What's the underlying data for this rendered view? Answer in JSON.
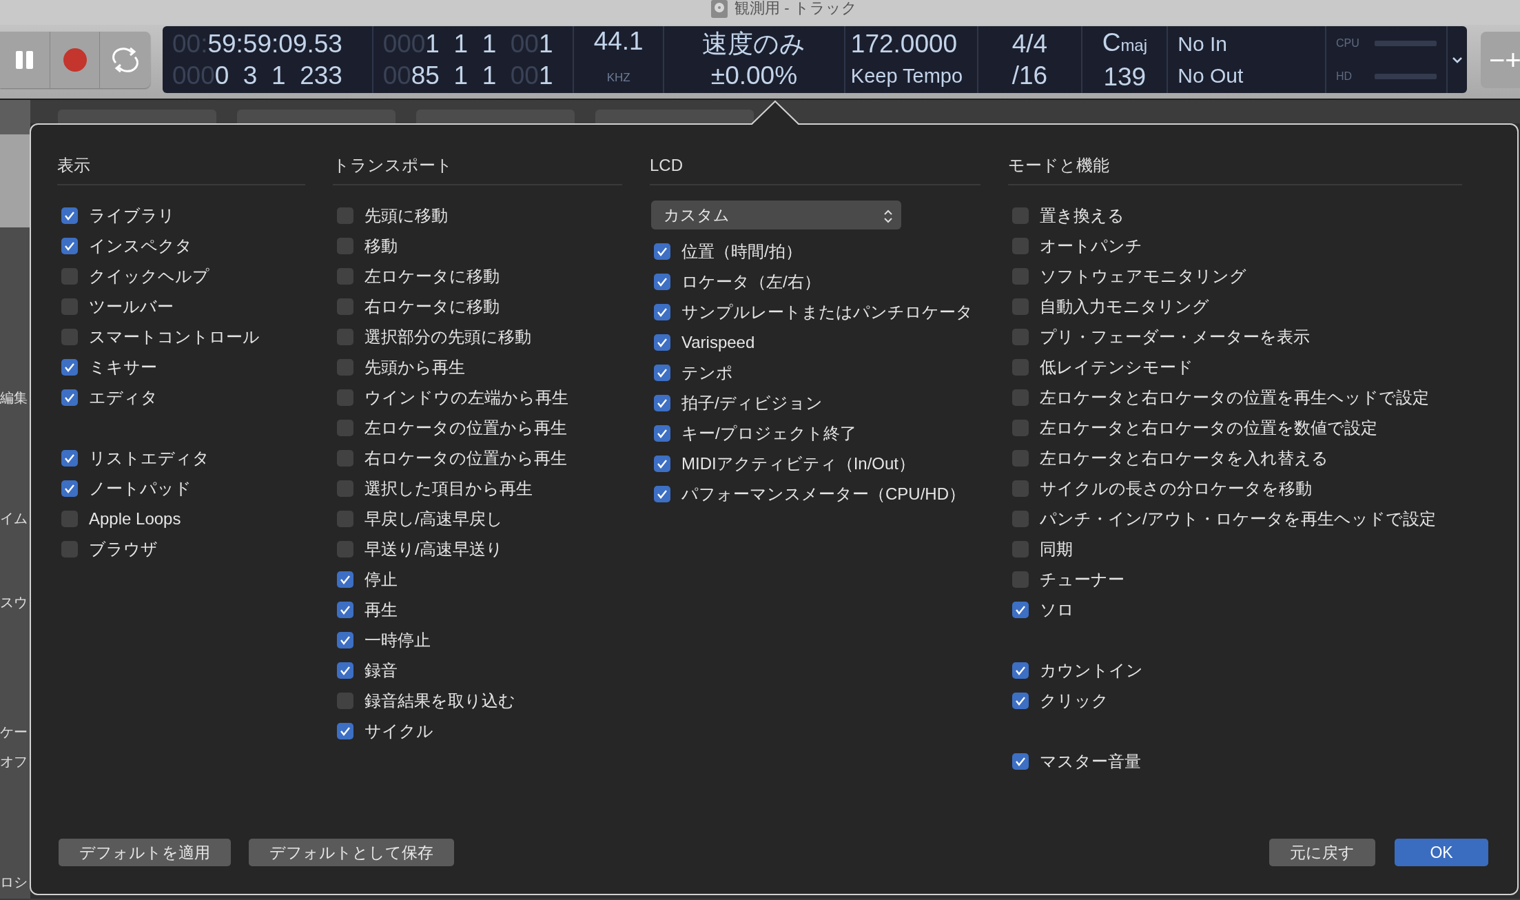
{
  "window": {
    "title": "観測用 - トラック"
  },
  "transport": [
    {
      "kind": "pause"
    },
    {
      "kind": "record"
    },
    {
      "kind": "cycle"
    }
  ],
  "lcd": {
    "segments": [
      {
        "lines": [
          [
            {
              "text": "00:",
              "dim": true
            },
            {
              "text": "59:59:09.53"
            }
          ],
          [
            {
              "text": "000",
              "dim": true
            },
            {
              "text": "0  3  1  233"
            }
          ]
        ]
      },
      {
        "lines": [
          [
            {
              "text": "000",
              "dim": true
            },
            {
              "text": "1  1  1  "
            },
            {
              "text": "00",
              "dim": true
            },
            {
              "text": "1"
            }
          ],
          [
            {
              "text": "00",
              "dim": true
            },
            {
              "text": "85  1  1  "
            },
            {
              "text": "00",
              "dim": true
            },
            {
              "text": "1"
            }
          ]
        ]
      },
      {
        "lines": [
          [
            {
              "text": "44.1"
            }
          ],
          [
            {
              "text": "KHZ",
              "small": true
            }
          ]
        ]
      },
      {
        "lines": [
          [
            {
              "text": "速度のみ"
            }
          ],
          [
            {
              "text": "±0.00%"
            }
          ]
        ]
      },
      {
        "lines": [
          [
            {
              "text": "172.0000"
            }
          ],
          [
            {
              "text": "Keep Tempo"
            }
          ]
        ]
      },
      {
        "lines": [
          [
            {
              "text": "4/4"
            }
          ],
          [
            {
              "text": "/16"
            }
          ]
        ]
      },
      {
        "lines": [
          [
            {
              "text": "C"
            },
            {
              "text": "maj",
              "small": true
            }
          ],
          [
            {
              "text": "139"
            }
          ]
        ]
      },
      {
        "lines": [
          [
            {
              "text": "No In"
            }
          ],
          [
            {
              "text": "No Out"
            }
          ]
        ]
      }
    ],
    "meters": [
      {
        "label": "CPU",
        "level": 0
      },
      {
        "label": "HD",
        "level": 0
      }
    ]
  },
  "zoom_button": "−+",
  "background": {
    "fragments": [
      "編集",
      "イム",
      "スウ",
      "ケー",
      "オフ",
      "ロシ"
    ]
  },
  "dialog": {
    "columns": [
      {
        "heading": "表示",
        "groups": [
          [
            {
              "label": "ライブラリ",
              "checked": true
            },
            {
              "label": "インスペクタ",
              "checked": true
            },
            {
              "label": "クイックヘルプ",
              "checked": false
            },
            {
              "label": "ツールバー",
              "checked": false
            },
            {
              "label": "スマートコントロール",
              "checked": false
            },
            {
              "label": "ミキサー",
              "checked": true
            },
            {
              "label": "エディタ",
              "checked": true
            }
          ],
          [
            {
              "label": "リストエディタ",
              "checked": true
            },
            {
              "label": "ノートパッド",
              "checked": true
            },
            {
              "label": "Apple Loops",
              "checked": false
            },
            {
              "label": "ブラウザ",
              "checked": false
            }
          ]
        ]
      },
      {
        "heading": "トランスポート",
        "groups": [
          [
            {
              "label": "先頭に移動",
              "checked": false
            },
            {
              "label": "移動",
              "checked": false
            },
            {
              "label": "左ロケータに移動",
              "checked": false
            },
            {
              "label": "右ロケータに移動",
              "checked": false
            },
            {
              "label": "選択部分の先頭に移動",
              "checked": false
            },
            {
              "label": "先頭から再生",
              "checked": false
            },
            {
              "label": "ウインドウの左端から再生",
              "checked": false
            },
            {
              "label": "左ロケータの位置から再生",
              "checked": false
            },
            {
              "label": "右ロケータの位置から再生",
              "checked": false
            },
            {
              "label": "選択した項目から再生",
              "checked": false
            },
            {
              "label": "早戻し/高速早戻し",
              "checked": false
            },
            {
              "label": "早送り/高速早送り",
              "checked": false
            },
            {
              "label": "停止",
              "checked": true
            },
            {
              "label": "再生",
              "checked": true
            },
            {
              "label": "一時停止",
              "checked": true
            },
            {
              "label": "録音",
              "checked": true
            },
            {
              "label": "録音結果を取り込む",
              "checked": false
            },
            {
              "label": "サイクル",
              "checked": true
            }
          ]
        ]
      },
      {
        "heading": "LCD",
        "dropdown": "カスタム",
        "groups": [
          [
            {
              "label": "位置（時間/拍）",
              "checked": true
            },
            {
              "label": "ロケータ（左/右）",
              "checked": true
            },
            {
              "label": "サンプルレートまたはパンチロケータ",
              "checked": true
            },
            {
              "label": "Varispeed",
              "checked": true
            },
            {
              "label": "テンポ",
              "checked": true
            },
            {
              "label": "拍子/ディビジョン",
              "checked": true
            },
            {
              "label": "キー/プロジェクト終了",
              "checked": true
            },
            {
              "label": "MIDIアクティビティ（In/Out）",
              "checked": true
            },
            {
              "label": "パフォーマンスメーター（CPU/HD）",
              "checked": true
            }
          ]
        ]
      },
      {
        "heading": "モードと機能",
        "groups": [
          [
            {
              "label": "置き換える",
              "checked": false
            },
            {
              "label": "オートパンチ",
              "checked": false
            },
            {
              "label": "ソフトウェアモニタリング",
              "checked": false
            },
            {
              "label": "自動入力モニタリング",
              "checked": false
            },
            {
              "label": "プリ・フェーダー・メーターを表示",
              "checked": false
            },
            {
              "label": "低レイテンシモード",
              "checked": false
            },
            {
              "label": "左ロケータと右ロケータの位置を再生ヘッドで設定",
              "checked": false
            },
            {
              "label": "左ロケータと右ロケータの位置を数値で設定",
              "checked": false
            },
            {
              "label": "左ロケータと右ロケータを入れ替える",
              "checked": false
            },
            {
              "label": "サイクルの長さの分ロケータを移動",
              "checked": false
            },
            {
              "label": "パンチ・イン/アウト・ロケータを再生ヘッドで設定",
              "checked": false
            },
            {
              "label": "同期",
              "checked": false
            },
            {
              "label": "チューナー",
              "checked": false
            },
            {
              "label": "ソロ",
              "checked": true
            }
          ],
          [
            {
              "label": "カウントイン",
              "checked": true
            },
            {
              "label": "クリック",
              "checked": true
            }
          ],
          [
            {
              "label": "マスター音量",
              "checked": true
            }
          ]
        ]
      }
    ],
    "buttons_left": [
      {
        "label": "デフォルトを適用",
        "primary": false
      },
      {
        "label": "デフォルトとして保存",
        "primary": false
      }
    ],
    "buttons_right": [
      {
        "label": "元に戻す",
        "primary": false
      },
      {
        "label": "OK",
        "primary": true
      }
    ]
  }
}
